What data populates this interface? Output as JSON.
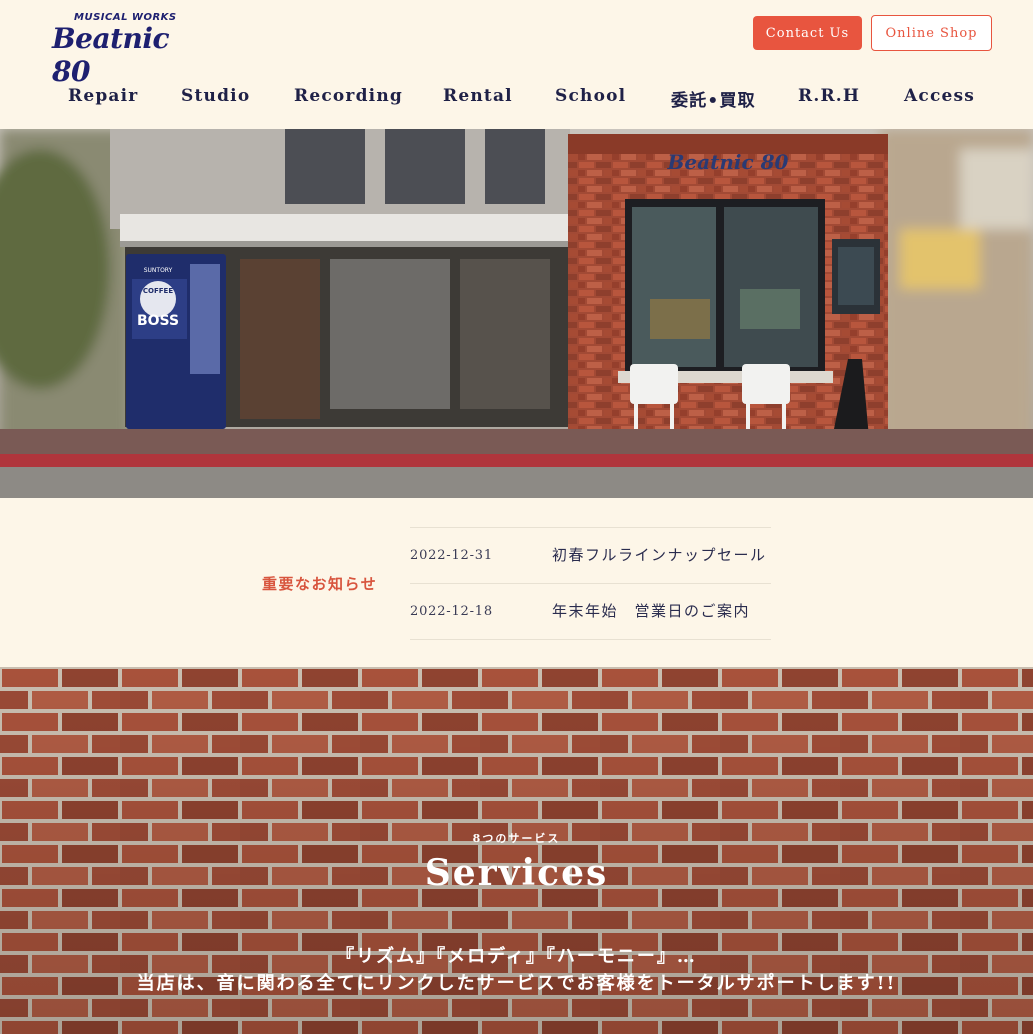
{
  "header": {
    "logo_small": "MUSICAL WORKS",
    "logo_main": "Beatnic 80",
    "contact_button": "Contact Us",
    "shop_button": "Online Shop"
  },
  "nav": {
    "items": [
      {
        "label": "Repair"
      },
      {
        "label": "Studio"
      },
      {
        "label": "Recording"
      },
      {
        "label": "Rental"
      },
      {
        "label": "School"
      },
      {
        "label": "委託•買取"
      },
      {
        "label": "R.R.H"
      },
      {
        "label": "Access"
      }
    ]
  },
  "hero": {
    "storefront_sign": "Beatnic 80",
    "vending_brand": "BOSS",
    "vending_sub": "COFFEE",
    "vending_top": "SUNTORY"
  },
  "news": {
    "heading": "重要なお知らせ",
    "items": [
      {
        "date": "2022-12-31",
        "title": "初春フルラインナップセール"
      },
      {
        "date": "2022-12-18",
        "title": "年末年始　営業日のご案内"
      }
    ]
  },
  "services": {
    "subtitle": "8つのサービス",
    "title": "Services",
    "line1": "『リズム』『メロディ』『ハーモニー』…",
    "line2": "当店は、音に関わる全てにリンクしたサービスでお客様をトータルサポートします!!"
  },
  "colors": {
    "background": "#fdf6e8",
    "accent": "#e8553f",
    "navy": "#1f2147",
    "brick": "#9b4a35"
  }
}
